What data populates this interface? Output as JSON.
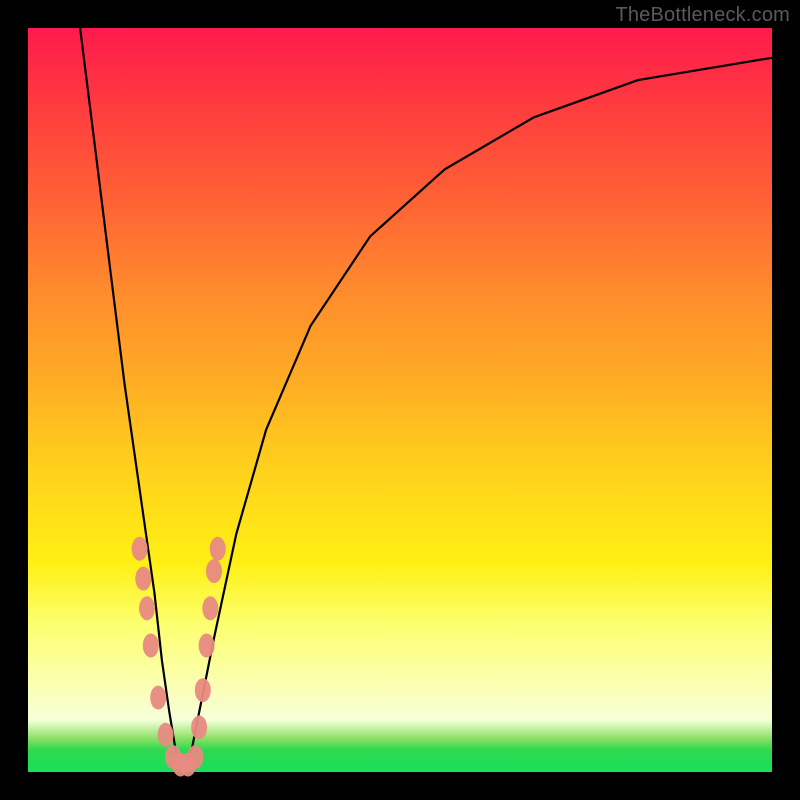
{
  "watermark": "TheBottleneck.com",
  "colors": {
    "frame": "#000000",
    "curve": "#000000",
    "marker_fill": "#e88a82",
    "gradient_top": "#ff1a4d",
    "gradient_mid": "#ffd31c",
    "gradient_bottom": "#18e05a"
  },
  "chart_data": {
    "type": "line",
    "title": "",
    "xlabel": "",
    "ylabel": "",
    "xlim": [
      0,
      100
    ],
    "ylim": [
      0,
      100
    ],
    "grid": false,
    "legend": false,
    "note": "V-shaped bottleneck curve. x is normalized component balance (0-100), y is bottleneck percentage (0-100). Minimum near x≈20. Values estimated from pixel positions; no axis tick labels are rendered in the image.",
    "series": [
      {
        "name": "bottleneck-curve",
        "x": [
          7,
          9,
          11,
          13,
          15,
          17,
          18,
          19,
          20,
          21,
          22,
          23,
          25,
          28,
          32,
          38,
          46,
          56,
          68,
          82,
          100
        ],
        "y": [
          100,
          84,
          68,
          52,
          38,
          24,
          15,
          8,
          2,
          1,
          3,
          8,
          18,
          32,
          46,
          60,
          72,
          81,
          88,
          93,
          96
        ]
      }
    ],
    "markers": {
      "name": "highlight-points",
      "note": "Salmon elliptical markers clustered near the trough on both arms of the V.",
      "points": [
        {
          "x": 15.0,
          "y": 30
        },
        {
          "x": 15.5,
          "y": 26
        },
        {
          "x": 16.0,
          "y": 22
        },
        {
          "x": 16.5,
          "y": 17
        },
        {
          "x": 17.5,
          "y": 10
        },
        {
          "x": 18.5,
          "y": 5
        },
        {
          "x": 19.5,
          "y": 2
        },
        {
          "x": 20.5,
          "y": 1
        },
        {
          "x": 21.5,
          "y": 1
        },
        {
          "x": 22.5,
          "y": 2
        },
        {
          "x": 23.0,
          "y": 6
        },
        {
          "x": 23.5,
          "y": 11
        },
        {
          "x": 24.0,
          "y": 17
        },
        {
          "x": 24.5,
          "y": 22
        },
        {
          "x": 25.0,
          "y": 27
        },
        {
          "x": 25.5,
          "y": 30
        }
      ]
    }
  }
}
